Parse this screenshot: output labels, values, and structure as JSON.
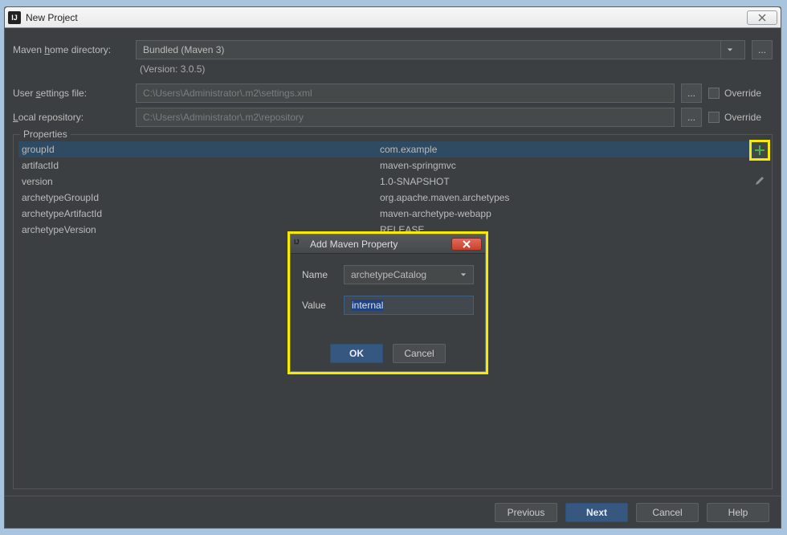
{
  "window": {
    "title": "New Project"
  },
  "form": {
    "home_label_pre": "Maven ",
    "home_label_u": "h",
    "home_label_post": "ome directory:",
    "home_value": "Bundled (Maven 3)",
    "version_note": "(Version: 3.0.5)",
    "settings_label_pre": "User ",
    "settings_label_u": "s",
    "settings_label_post": "ettings file:",
    "settings_value": "C:\\Users\\Administrator\\.m2\\settings.xml",
    "repo_label_pre": "",
    "repo_label_u": "L",
    "repo_label_post": "ocal repository:",
    "repo_value": "C:\\Users\\Administrator\\.m2\\repository",
    "override_label": "Override",
    "browse_label": "..."
  },
  "properties": {
    "title": "Properties",
    "rows": [
      {
        "key": "groupId",
        "val": "com.example"
      },
      {
        "key": "artifactId",
        "val": "maven-springmvc"
      },
      {
        "key": "version",
        "val": "1.0-SNAPSHOT"
      },
      {
        "key": "archetypeGroupId",
        "val": "org.apache.maven.archetypes"
      },
      {
        "key": "archetypeArtifactId",
        "val": "maven-archetype-webapp"
      },
      {
        "key": "archetypeVersion",
        "val": "RELEASE"
      }
    ]
  },
  "modal": {
    "title": "Add Maven Property",
    "name_label": "Name",
    "name_value": "archetypeCatalog",
    "value_label": "Value",
    "value_value": "internal",
    "ok_label": "OK",
    "cancel_label": "Cancel"
  },
  "footer": {
    "previous_pre": "",
    "previous_u": "P",
    "previous_post": "revious",
    "next_pre": "",
    "next_u": "N",
    "next_post": "ext",
    "cancel": "Cancel",
    "help": "Help"
  }
}
